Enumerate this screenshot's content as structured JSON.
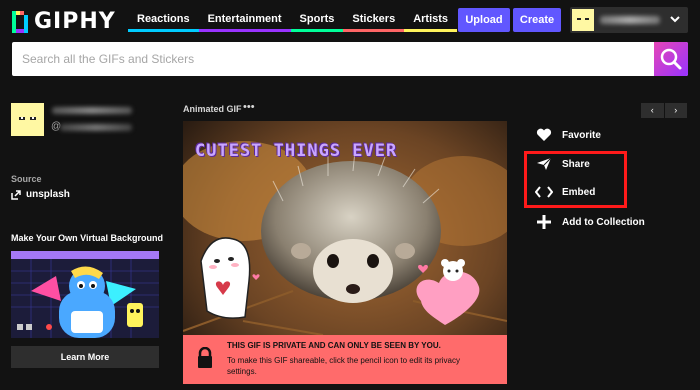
{
  "header": {
    "logo_text": "GIPHY",
    "nav": [
      {
        "label": "Reactions",
        "color": "#00ccff"
      },
      {
        "label": "Entertainment",
        "color": "#9933ff"
      },
      {
        "label": "Sports",
        "color": "#00ff99"
      },
      {
        "label": "Stickers",
        "color": "#ff6666"
      },
      {
        "label": "Artists",
        "color": "#fff35c"
      }
    ],
    "more_label": "⋮",
    "upload_label": "Upload",
    "create_label": "Create"
  },
  "search": {
    "placeholder": "Search all the GIFs and Stickers"
  },
  "uploader": {
    "at": "@"
  },
  "source": {
    "label": "Source",
    "value": "unsplash"
  },
  "virtual_background": {
    "title": "Make Your Own Virtual Background",
    "button_label": "Learn More"
  },
  "gif": {
    "type_label": "Animated GIF",
    "more_label": "•••",
    "overlay_title": "CUTEST THINGS EVER",
    "private_title": "THIS GIF IS PRIVATE AND CAN ONLY BE SEEN BY YOU.",
    "private_body": "To make this GIF shareable, click the pencil icon to edit its privacy settings."
  },
  "pager": {
    "prev": "‹",
    "next": "›"
  },
  "actions": {
    "favorite": "Favorite",
    "share": "Share",
    "embed": "Embed",
    "add_to_collection": "Add to Collection"
  },
  "colors": {
    "accent": "#6157ff",
    "highlight": "#ff1a1a",
    "private_banner": "#ff6b6b"
  }
}
